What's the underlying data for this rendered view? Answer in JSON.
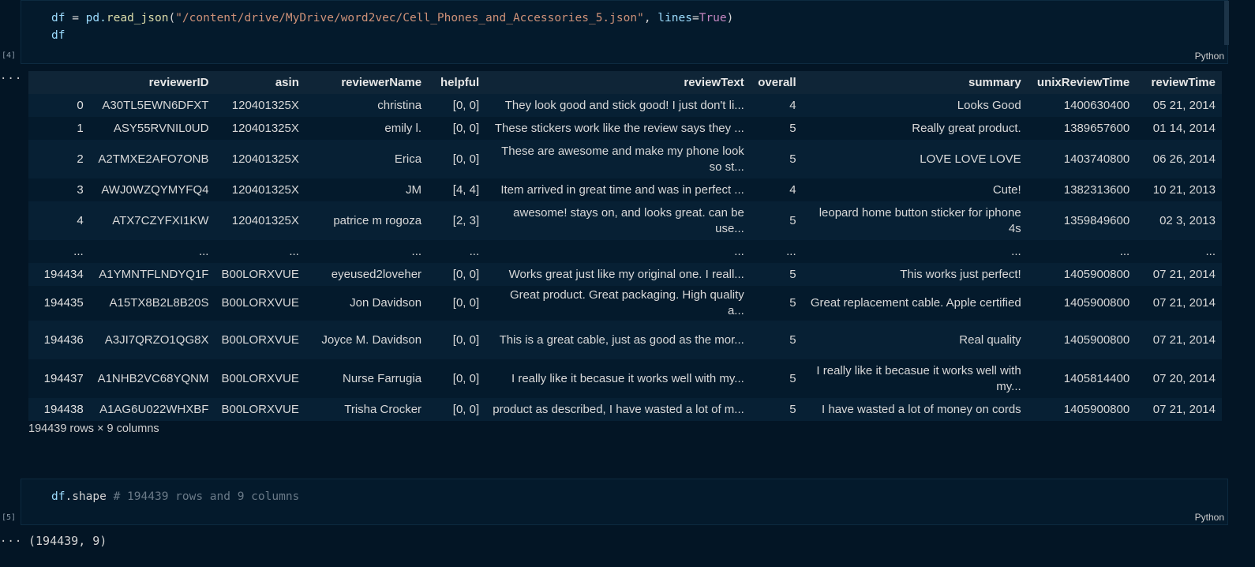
{
  "cell1": {
    "exec_count": "[4]",
    "language": "Python",
    "code": {
      "line1_var": "df",
      "line1_eq": " = ",
      "line1_obj": "pd.",
      "line1_fn": "read_json",
      "line1_open": "(",
      "line1_path": "\"/content/drive/MyDrive/word2vec/Cell_Phones_and_Accessories_5.json\"",
      "line1_comma": ", ",
      "line1_kwarg": "lines",
      "line1_assign": "=",
      "line1_bool": "True",
      "line1_close": ")",
      "line2": "df"
    }
  },
  "output1": {
    "ellipsis": "...",
    "columns": [
      "",
      "reviewerID",
      "asin",
      "reviewerName",
      "helpful",
      "reviewText",
      "overall",
      "summary",
      "unixReviewTime",
      "reviewTime"
    ],
    "rows": [
      [
        "0",
        "A30TL5EWN6DFXT",
        "120401325X",
        "christina",
        "[0, 0]",
        "They look good and stick good! I just don't li...",
        "4",
        "Looks Good",
        "1400630400",
        "05 21, 2014"
      ],
      [
        "1",
        "ASY55RVNIL0UD",
        "120401325X",
        "emily l.",
        "[0, 0]",
        "These stickers work like the review says they ...",
        "5",
        "Really great product.",
        "1389657600",
        "01 14, 2014"
      ],
      [
        "2",
        "A2TMXE2AFO7ONB",
        "120401325X",
        "Erica",
        "[0, 0]",
        "These are awesome and make my phone look so st...",
        "5",
        "LOVE LOVE LOVE",
        "1403740800",
        "06 26, 2014"
      ],
      [
        "3",
        "AWJ0WZQYMYFQ4",
        "120401325X",
        "JM",
        "[4, 4]",
        "Item arrived in great time and was in perfect ...",
        "4",
        "Cute!",
        "1382313600",
        "10 21, 2013"
      ],
      [
        "4",
        "ATX7CZYFXI1KW",
        "120401325X",
        "patrice m rogoza",
        "[2, 3]",
        "awesome! stays on, and looks great. can be use...",
        "5",
        "leopard home button sticker for iphone 4s",
        "1359849600",
        "02 3, 2013"
      ],
      [
        "...",
        "...",
        "...",
        "...",
        "...",
        "...",
        "...",
        "...",
        "...",
        "..."
      ],
      [
        "194434",
        "A1YMNTFLNDYQ1F",
        "B00LORXVUE",
        "eyeused2loveher",
        "[0, 0]",
        "Works great just like my original one. I reall...",
        "5",
        "This works just perfect!",
        "1405900800",
        "07 21, 2014"
      ],
      [
        "194435",
        "A15TX8B2L8B20S",
        "B00LORXVUE",
        "Jon Davidson",
        "[0, 0]",
        "Great product. Great packaging. High quality a...",
        "5",
        "Great replacement cable. Apple certified",
        "1405900800",
        "07 21, 2014"
      ],
      [
        "194436",
        "A3JI7QRZO1QG8X",
        "B00LORXVUE",
        "Joyce M. Davidson",
        "[0, 0]",
        "This is a great cable, just as good as the mor...",
        "5",
        "Real quality",
        "1405900800",
        "07 21, 2014"
      ],
      [
        "194437",
        "A1NHB2VC68YQNM",
        "B00LORXVUE",
        "Nurse Farrugia",
        "[0, 0]",
        "I really like it becasue it works well with my...",
        "5",
        "I really like it becasue it works well with my...",
        "1405814400",
        "07 20, 2014"
      ],
      [
        "194438",
        "A1AG6U022WHXBF",
        "B00LORXVUE",
        "Trisha Crocker",
        "[0, 0]",
        "product as described, I have wasted a lot of m...",
        "5",
        "I have wasted a lot of money on cords",
        "1405900800",
        "07 21, 2014"
      ]
    ],
    "summary": "194439 rows × 9 columns"
  },
  "cell2": {
    "exec_count": "[5]",
    "language": "Python",
    "code_var": "df",
    "code_attr": ".shape",
    "code_comment": " # 194439 rows and 9 columns"
  },
  "output2": {
    "ellipsis": "...",
    "value": "(194439, 9)"
  }
}
